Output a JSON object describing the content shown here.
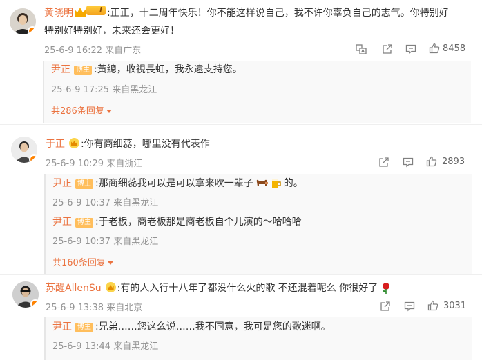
{
  "comments": [
    {
      "author": "黄晓明",
      "text": ":正正，十二周年快乐！你不能这样说自己，我不许你辜负自己的志气。你特别好",
      "text_line2": "特别好特别好，未来还会更好！",
      "meta": "25-6-9 16:22 来自广东",
      "likes": "8458",
      "vip_level": "I",
      "replies": [
        {
          "author": "尹正",
          "tag": "博主",
          "text": ":黃總，收視長虹，我永遠支持您。",
          "meta": "25-6-9 17:25 来自黑龙江"
        }
      ],
      "more": "共286条回复"
    },
    {
      "author": "于正",
      "text": ":你有商细蕊，哪里没有代表作",
      "meta": "25-6-9 10:29 来自浙江",
      "likes": "2893",
      "replies": [
        {
          "author": "尹正",
          "tag": "博主",
          "text": ":那商细蕊我可以是可以拿来吹一辈子",
          "text_after": "的。",
          "meta": "25-6-9 10:37 来自黑龙江"
        },
        {
          "author": "尹正",
          "tag": "博主",
          "text": ":于老板，商老板那是商老板自个儿演的～哈哈哈",
          "meta": "25-6-9 10:37 来自黑龙江"
        }
      ],
      "more": "共160条回复"
    },
    {
      "author": "苏醒AllenSu",
      "text": ":有的人入行十八年了都没什么火的歌 不还混着呢么 你很好了",
      "meta": "25-6-9 13:38 来自北京",
      "likes": "3031",
      "replies": [
        {
          "author": "尹正",
          "tag": "博主",
          "text": ":兄弟……您这么说……我不同意，我可是您的歌迷啊。",
          "meta": "25-6-9 13:44 来自黑龙江"
        }
      ]
    }
  ],
  "icons": {
    "translate": "translate-icon",
    "share": "share-icon",
    "comment": "comment-icon",
    "like": "like-icon"
  },
  "colors": {
    "name": "#eb7340",
    "meta": "#939393",
    "tag": "#ffbe5c",
    "text": "#333333"
  }
}
